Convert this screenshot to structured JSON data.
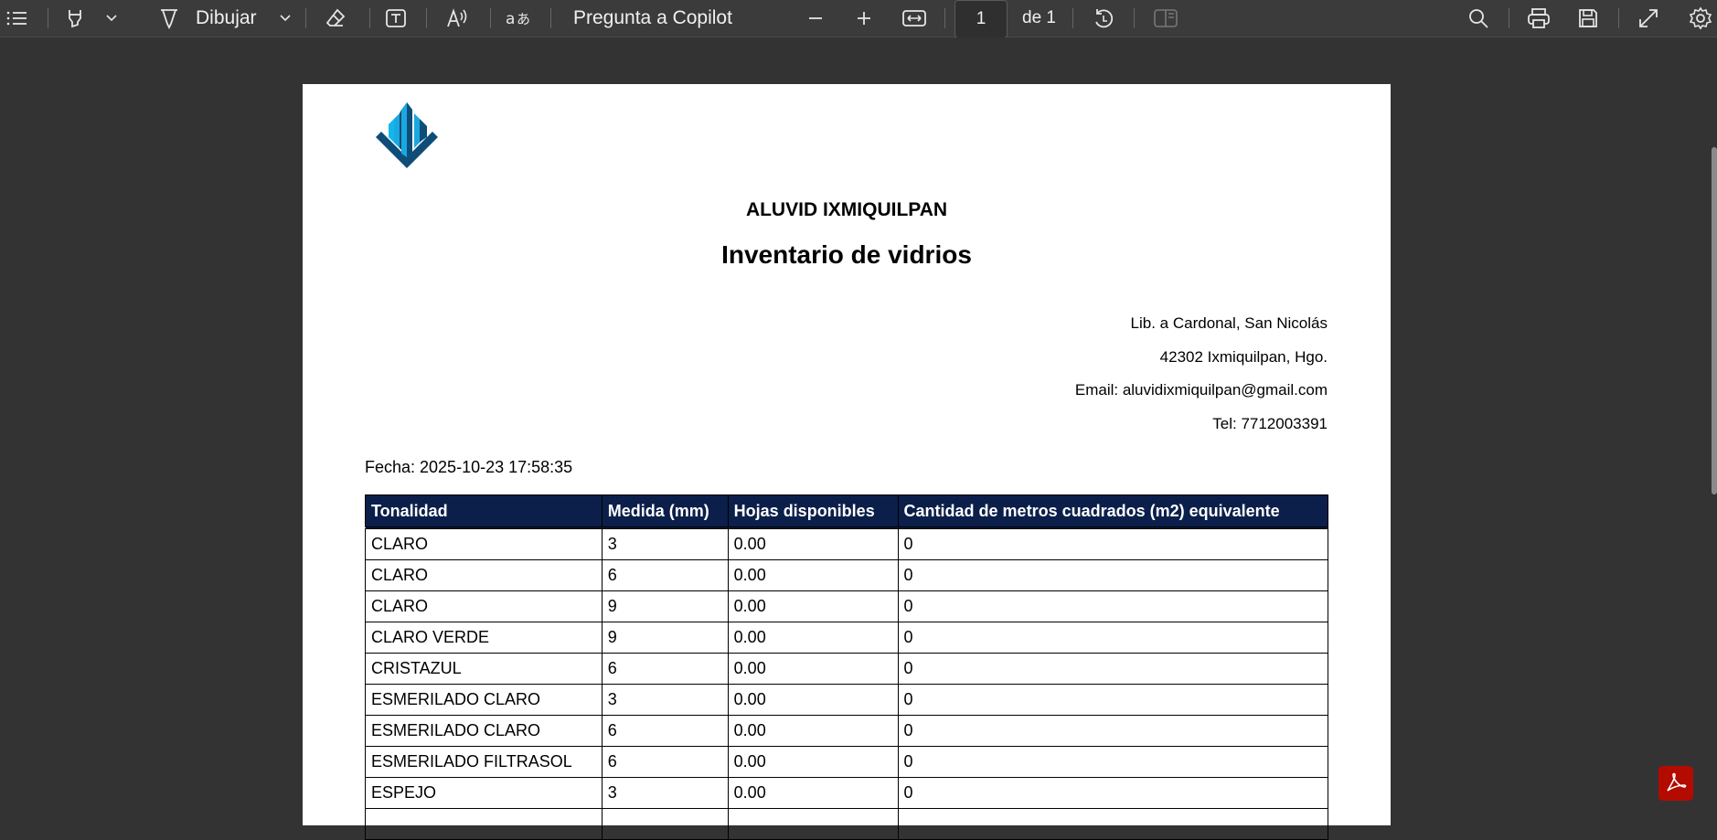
{
  "toolbar": {
    "draw_label": "Dibujar",
    "copilot_label": "Pregunta a Copilot",
    "page_current": "1",
    "page_total": "de 1"
  },
  "document": {
    "company": "ALUVID IXMIQUILPAN",
    "title": "Inventario de vidrios",
    "address_lines": [
      "Lib. a Cardonal, San Nicolás",
      "42302 Ixmiquilpan, Hgo.",
      "Email: aluvidixmiquilpan@gmail.com",
      "Tel: 7712003391"
    ],
    "date": "Fecha: 2025-10-23 17:58:35",
    "table": {
      "headers": [
        "Tonalidad",
        "Medida (mm)",
        "Hojas disponibles",
        "Cantidad de metros cuadrados (m2) equivalente"
      ],
      "rows": [
        [
          "CLARO",
          "3",
          "0.00",
          "0"
        ],
        [
          "CLARO",
          "6",
          "0.00",
          "0"
        ],
        [
          "CLARO",
          "9",
          "0.00",
          "0"
        ],
        [
          "CLARO VERDE",
          "9",
          "0.00",
          "0"
        ],
        [
          "CRISTAZUL",
          "6",
          "0.00",
          "0"
        ],
        [
          "ESMERILADO CLARO",
          "3",
          "0.00",
          "0"
        ],
        [
          "ESMERILADO CLARO",
          "6",
          "0.00",
          "0"
        ],
        [
          "ESMERILADO FILTRASOL",
          "6",
          "0.00",
          "0"
        ],
        [
          "ESPEJO",
          "3",
          "0.00",
          "0"
        ],
        [
          "",
          "",
          "",
          ""
        ]
      ]
    }
  },
  "colors": {
    "toolbar_bg": "#3b3b3b",
    "viewer_bg": "#333333",
    "table_header_bg": "#0b1f4a",
    "logo_blue": "#1aa8e0",
    "logo_dark": "#0d4d78",
    "acrobat_red": "#b30b00"
  },
  "icons": [
    "menu-icon",
    "highlighter-icon",
    "chevron-down-icon",
    "pen-icon",
    "eraser-icon",
    "text-box-icon",
    "read-aloud-icon",
    "translate-icon",
    "zoom-out-icon",
    "zoom-in-icon",
    "fit-width-icon",
    "rotate-icon",
    "two-page-icon",
    "search-icon",
    "print-icon",
    "save-icon",
    "fullscreen-icon",
    "settings-icon",
    "acrobat-icon"
  ]
}
